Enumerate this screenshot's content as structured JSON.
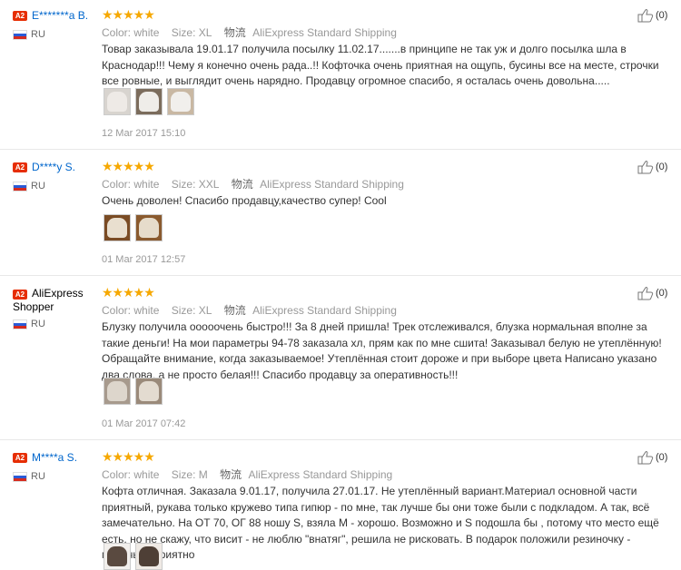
{
  "colors": {
    "accent_link": "#0066cc",
    "star": "#f6a800",
    "badge": "#e62e04"
  },
  "reviews": [
    {
      "level": "A2",
      "name": "E*******a B.",
      "country": "RU",
      "stars": "★★★★★",
      "rating": 5,
      "color_label": "Color:",
      "color_value": "white",
      "size_label": "Size:",
      "size_value": "XL",
      "ship_icon": "物流",
      "shipping": "AliExpress Standard Shipping",
      "text": "Товар заказывала 19.01.17 получила посылку 11.02.17.......в принципе не так уж и долго посылка шла в Краснодар!!! Чему я конечно очень рада..!! Кофточка очень приятная на ощупь, бусины все на месте, строчки все ровные, и выглядит очень нарядно. Продавцу огромное спасибо, я осталась очень довольна.....",
      "photos": 3,
      "date": "12 Mar 2017 15:10",
      "useful": "(0)"
    },
    {
      "level": "A2",
      "name": "D****y S.",
      "country": "RU",
      "stars": "★★★★★",
      "rating": 5,
      "color_label": "Color:",
      "color_value": "white",
      "size_label": "Size:",
      "size_value": "XXL",
      "ship_icon": "物流",
      "shipping": "AliExpress Standard Shipping",
      "text": "Очень доволен! Спасибо продавцу,качество супер! Cool",
      "photos": 2,
      "date": "01 Mar 2017 12:57",
      "useful": "(0)"
    },
    {
      "level": "A2",
      "name": "AliExpress Shopper",
      "country": "RU",
      "stars": "★★★★★",
      "rating": 5,
      "color_label": "Color:",
      "color_value": "white",
      "size_label": "Size:",
      "size_value": "XL",
      "ship_icon": "物流",
      "shipping": "AliExpress Standard Shipping",
      "text": "Блузку получила ооооочень быстро!!! За 8 дней пришла! Трек отслеживался, блузка нормальная вполне за такие деньги! На мои параметры 94-78 заказала хл, прям как по мне сшита! Заказывал белую не утеплённую! Обращайте внимание, когда заказываемое! Утеплённая стоит дороже и при выборе цвета Написано указано два слова, а не просто белая!!! Спасибо продавцу за оперативность!!!",
      "photos": 2,
      "date": "01 Mar 2017 07:42",
      "useful": "(0)"
    },
    {
      "level": "A2",
      "name": "M****a S.",
      "country": "RU",
      "stars": "★★★★★",
      "rating": 5,
      "color_label": "Color:",
      "color_value": "white",
      "size_label": "Size:",
      "size_value": "M",
      "ship_icon": "物流",
      "shipping": "AliExpress Standard Shipping",
      "text": "Кофта отличная. Заказала 9.01.17, получила 27.01.17. Не утеплённый вариант.Материал основной части приятный, рукава только кружево типа гипюр - по мне, так лучше бы они тоже были с подкладом. А так, всё замечательно. На ОТ 70, ОГ 88 ношу S, взяла М - хорошо. Возможно и S подошла бы , потому что место ещё есть, но не скажу, что висит - не люблю \"внатяг\", решила не рисковать. В подарок положили резиночку - мелочь, а приятно",
      "photos": 2,
      "useful": "(0)"
    }
  ]
}
